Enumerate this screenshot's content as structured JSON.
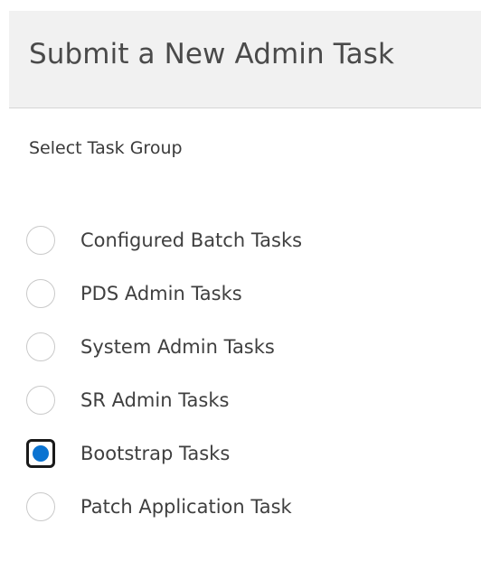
{
  "header": {
    "title": "Submit a New Admin Task"
  },
  "task_group": {
    "label": "Select Task Group",
    "selected_index": 4,
    "options": [
      "Configured Batch Tasks",
      "PDS Admin Tasks",
      "System Admin Tasks",
      "SR Admin Tasks",
      "Bootstrap Tasks",
      "Patch Application Task"
    ]
  },
  "colors": {
    "accent": "#0a73d1",
    "header_bg": "#f1f1f1"
  }
}
